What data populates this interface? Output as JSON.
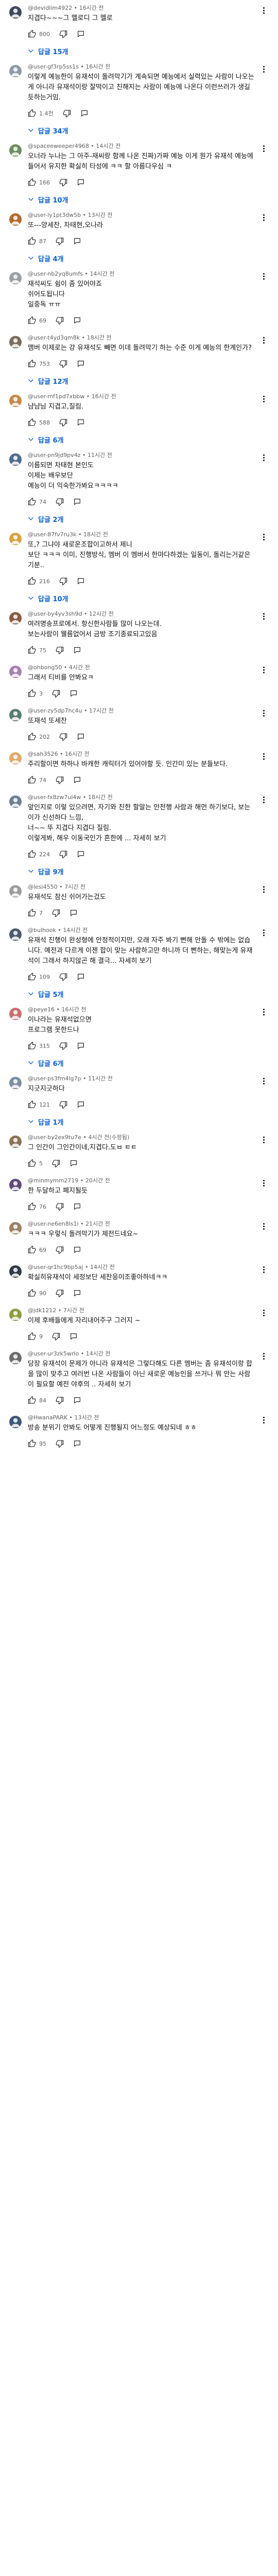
{
  "colors": {
    "link": "#065fd4",
    "meta": "#606060",
    "text": "#0f0f0f"
  },
  "icons": {
    "like": "thumb-up-icon",
    "dislike": "thumb-down-icon",
    "reply": "reply-icon",
    "more": "more-vert-icon",
    "replies": "chevron-down-icon"
  },
  "comments": [
    {
      "author": "@devidlim4922",
      "time": "16시간 전",
      "text": "지겹다~~~그 멜로디 그 멜로",
      "likes": "800",
      "replies_label": "답글 15개",
      "avatar_color": "#3d4a5c"
    },
    {
      "author": "@user-gf3rp5ss1s",
      "time": "16시간 전",
      "text": "이렇게 예능한이 유재석이 돌려막기가 계속되면 예능에서 실력있는 사람이 나오는게 아니라 유재석이랑 찰떡이고 친해지는 사람이 예능에 나온다 이런쓰러가 생길듯하는거임.",
      "likes": "1.4천",
      "replies_label": "답글 34개",
      "avatar_color": "#8d9aa8"
    },
    {
      "author": "@spaceeweeper4968",
      "time": "14시간 전",
      "text": "오너라 누나는 그 아주-재씨랑 함께 나온 진짜)가짜 예능 이게 뭔가 유재석 예능에 들어서 유지한 확실히 타성에 ㅋㅋ 할 아름다우심 ㅋ",
      "likes": "166",
      "replies_label": "답글 10개",
      "avatar_color": "#6e8f5f"
    },
    {
      "author": "@user-ly1pt3dw5b",
      "time": "13시간 전",
      "text": "또---양세찬, 차태현,오나라",
      "likes": "87",
      "replies_label": "답글 4개",
      "avatar_color": "#b56b2d"
    },
    {
      "author": "@user-nb2yq8umfs",
      "time": "14시간 전",
      "text": "재석씨도 쉼이 좀 있어야죠\n쉬어도됩니다\n일중독 ㅠㅠ",
      "likes": "69",
      "replies_label": "",
      "avatar_color": "#9aa0a6"
    },
    {
      "author": "@user-t4yd3qm8k",
      "time": "18시간 전",
      "text": "맴버 이제로는 걍 유재석도 빼면 이데 돌려막기 하는 수준 이게 예능의 한계인가?",
      "likes": "753",
      "replies_label": "답글 12개",
      "avatar_color": "#7b6d5a"
    },
    {
      "author": "@user-mf1pd7xbbw",
      "time": "16시간 전",
      "text": "냠냠님 지겹고,질림.",
      "likes": "588",
      "replies_label": "답글 6개",
      "avatar_color": "#c58a4b"
    },
    {
      "author": "@user-pn9jd9pv4z",
      "time": "11시간 전",
      "text": "이름되면 차태현 본인도\n이제는 배우보단\n예능이 더 익숙한가봐요ㅋㅋㅋㅋ",
      "likes": "74",
      "replies_label": "답글 2개",
      "avatar_color": "#4f6d8f"
    },
    {
      "author": "@user-87fv7ru3k",
      "time": "18시간 전",
      "text": "또,? 그냐야 새로운조합이고하서 제니\n보단 ㅋㅋㅋ 이미, 진행방식, 멤버 이 멤버서 한마다하겠는 일동이, 돌리는거같은 기분..",
      "likes": "216",
      "replies_label": "답글 10개",
      "avatar_color": "#d9a441"
    },
    {
      "author": "@user-by4yv3sh9d",
      "time": "12시간 전",
      "text": "여려명송프로에서. 항신한사람들 많이 나오는데.\n보는사람이 웰름없어서 금방 조기종료되고있음",
      "likes": "75",
      "replies_label": "",
      "avatar_color": "#8a5a44"
    },
    {
      "author": "@ohbong50",
      "time": "4시간 전",
      "text": "그래서 티비를 안봐요ㅋ",
      "likes": "3",
      "replies_label": "",
      "avatar_color": "#a77fb0"
    },
    {
      "author": "@user-zy5dp7hc4u",
      "time": "17시간 전",
      "text": "또재석 또세찬",
      "likes": "202",
      "replies_label": "",
      "avatar_color": "#5b7c6e"
    },
    {
      "author": "@sah3526",
      "time": "16시간 전",
      "text": "주리할이면 하하나 바캐한 캐릭터가 있어야할 듯. 인간미 있는 분들보다.",
      "likes": "74",
      "replies_label": "",
      "avatar_color": "#e0a96d"
    },
    {
      "author": "@user-fx8zw7ul4w",
      "time": "18시간 전",
      "text": "앞인지로 이렇 있으려면, 자기와 친한 할말는 안전행 사람과 해먼 하기보다, 보는이가 신선하다 느낌,\n너~~ 뚜 지겹다 지겹다 질림.\n이렇게봐, 해우 이동국인가 흔한에 ... 자세히 보기",
      "likes": "224",
      "replies_label": "답글 9개",
      "avatar_color": "#6a7f98"
    },
    {
      "author": "@lesi4550",
      "time": "7시간 전",
      "text": "유재석도 참신 쉬어가는겄도",
      "likes": "7",
      "replies_label": "",
      "avatar_color": "#9c9c9c"
    },
    {
      "author": "@bulhook",
      "time": "14시간 전",
      "text": "유재석 진행이 완성형에 안정적이지만, 오래 자주 봐기 뻔해 안돌 수 밖에는 없습니다. 예전과 다르게 이젠 합이 맞는 사람하고만 하니까 더 뻔하는, 해맞는게 유재석이 그래서 하지않곤 해 결극... 자세히 보기",
      "likes": "109",
      "replies_label": "답글 5개",
      "avatar_color": "#4d5b70"
    },
    {
      "author": "@peye16",
      "time": "16시간 전",
      "text": "이나라는 유재석없으면\n프로그램 못한드나",
      "likes": "315",
      "replies_label": "답글 6개",
      "avatar_color": "#c96f6f"
    },
    {
      "author": "@user-ps3fm4lg7p",
      "time": "11시간 전",
      "text": "지긋지긋하다",
      "likes": "121",
      "replies_label": "답글 1개",
      "avatar_color": "#7a8fa3"
    },
    {
      "author": "@user-by2ex9tu7e",
      "time": "4시간 전(수정됨)",
      "text": "그 인간이 그인간이네,지겹다.도ㅂ ㅌㅌ",
      "likes": "5",
      "replies_label": "",
      "avatar_color": "#8b7355"
    },
    {
      "author": "@minmymm2719",
      "time": "20시간 전",
      "text": "한 두달하고 폐지될듯",
      "likes": "76",
      "replies_label": "",
      "avatar_color": "#5f4b7a"
    },
    {
      "author": "@user-ne6en8ls1i",
      "time": "21시간 전",
      "text": "ㅋㅋㅋ 우렇식 돌려막기가 제전드네요~",
      "likes": "69",
      "replies_label": "",
      "avatar_color": "#9b8166"
    },
    {
      "author": "@user-qr1hc9bp5aj",
      "time": "14시간 전",
      "text": "확실히유재석이 세정보단 세찬응이조좋아하네ㅋㅋ",
      "likes": "90",
      "replies_label": "",
      "avatar_color": "#2f3b47"
    },
    {
      "author": "@jdk1212",
      "time": "7시간 전",
      "text": "이제 후배들에게 자리내어주구 그러지 ~",
      "likes": "9",
      "replies_label": "",
      "avatar_color": "#8f9b3f"
    },
    {
      "author": "@user-ur3zk5wrlo",
      "time": "14시간 전",
      "text": "당장 유재석이 문제가 아니라 유재석은 그렇다해도 다른 멤버는 좀 유재석이랑 합을 많이 맞추고 여러번 나온 사람들이 아닌 새로운 예능인을 쓰거나 뭐 안는 사람이 필요할 예전 야후의 .. 자세히 보기",
      "likes": "84",
      "replies_label": "",
      "avatar_color": "#6e6e6e"
    },
    {
      "author": "@HwanaPARK",
      "time": "13시간 전",
      "text": "방송 분위기 안봐도 어떻게 진행될지 어느정도 예상되네 ㅎㅎ",
      "likes": "95",
      "replies_label": "",
      "avatar_color": "#3c5a78"
    }
  ]
}
